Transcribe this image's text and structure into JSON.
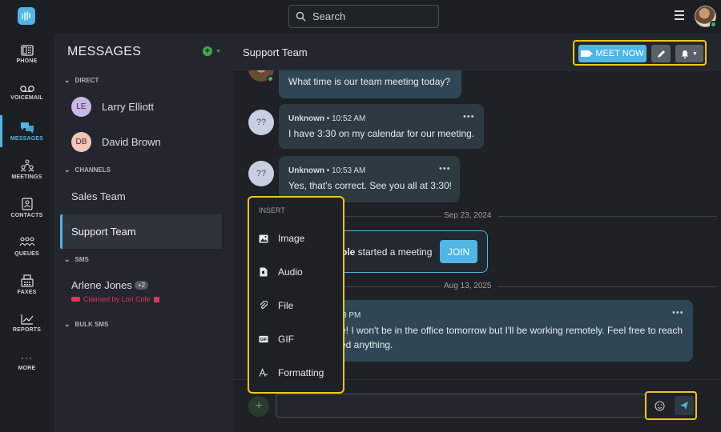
{
  "topbar": {
    "search_placeholder": "Search"
  },
  "rail": {
    "items": [
      {
        "label": "PHONE",
        "icon": "phone-icon"
      },
      {
        "label": "VOICEMAIL",
        "icon": "voicemail-icon"
      },
      {
        "label": "MESSAGES",
        "icon": "messages-icon",
        "active": true
      },
      {
        "label": "MEETINGS",
        "icon": "meetings-icon"
      },
      {
        "label": "CONTACTS",
        "icon": "contacts-icon"
      },
      {
        "label": "QUEUES",
        "icon": "queues-icon"
      },
      {
        "label": "FAXES",
        "icon": "fax-icon"
      },
      {
        "label": "REPORTS",
        "icon": "reports-icon"
      },
      {
        "label": "MORE",
        "icon": "more-icon"
      }
    ]
  },
  "panel": {
    "title": "MESSAGES",
    "sections": {
      "direct": "DIRECT",
      "channels": "CHANNELS",
      "sms": "SMS",
      "bulk_sms": "BULK SMS"
    },
    "direct": [
      {
        "initials": "LE",
        "name": "Larry Elliott"
      },
      {
        "initials": "DB",
        "name": "David Brown"
      }
    ],
    "channels": [
      "Sales Team",
      "Support Team"
    ],
    "sms": {
      "name": "Arlene Jones",
      "badge": "+2",
      "claimed": "Claimed by Lori Cole"
    }
  },
  "chat": {
    "title": "Support Team",
    "meet_now": "MEET NOW",
    "messages": [
      {
        "text": "What time is our team meeting today?"
      },
      {
        "sender": "Unknown",
        "time": "10:52 AM",
        "avatar": "??",
        "text": "I have 3:30 on my calendar for our meeting."
      },
      {
        "sender": "Unknown",
        "time": "10:53 AM",
        "avatar": "??",
        "text": "Yes, that's correct. See you all at 3:30!"
      }
    ],
    "date_1": "Sep 23, 2024",
    "meeting_name_fragment": "ole",
    "meeting_text": " started a meeting",
    "join": "JOIN",
    "date_2": "Aug 13, 2025",
    "last_msg": {
      "time_fragment": "3 PM",
      "line1": "e! I won't be in the office tomorrow but I'll be working remotely. Feel free to reach",
      "line2": "ed anything."
    },
    "more": "•••"
  },
  "insert_menu": {
    "header": "INSERT",
    "items": [
      {
        "label": "Image",
        "icon": "image-icon"
      },
      {
        "label": "Audio",
        "icon": "audio-icon"
      },
      {
        "label": "File",
        "icon": "paperclip-icon"
      },
      {
        "label": "GIF",
        "icon": "gif-icon"
      },
      {
        "label": "Formatting",
        "icon": "formatting-icon"
      }
    ]
  },
  "colors": {
    "accent": "#4fb6e6",
    "highlight": "#f5c518",
    "online": "#3cb371",
    "claimed": "#e0335e"
  }
}
